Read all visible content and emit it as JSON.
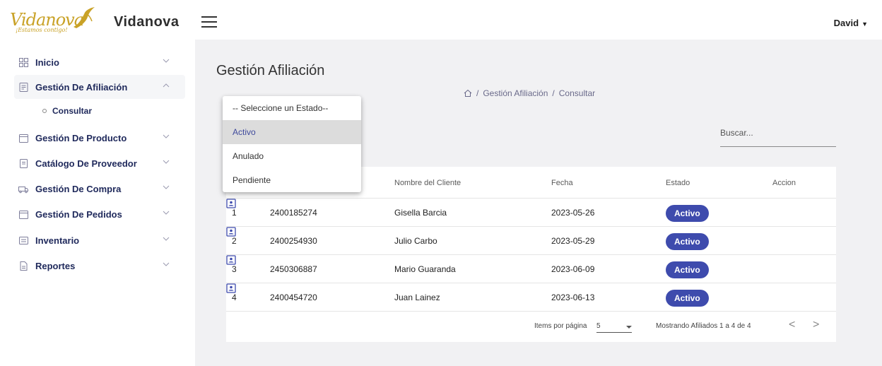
{
  "header": {
    "logo_text": "Vidanova",
    "logo_tagline": "¡Estamos contigo!",
    "brand": "Vidanova",
    "user": "David"
  },
  "sidebar": {
    "items": [
      {
        "label": "Inicio",
        "icon": "grid-icon"
      },
      {
        "label": "Gestión De Afiliación",
        "icon": "form-icon",
        "expanded": true,
        "children": [
          {
            "label": "Consultar"
          }
        ]
      },
      {
        "label": "Gestión De Producto",
        "icon": "calendar-icon"
      },
      {
        "label": "Catálogo De Proveedor",
        "icon": "document-icon"
      },
      {
        "label": "Gestión De Compra",
        "icon": "truck-icon"
      },
      {
        "label": "Gestión De Pedidos",
        "icon": "calendar-icon"
      },
      {
        "label": "Inventario",
        "icon": "list-icon"
      },
      {
        "label": "Reportes",
        "icon": "file-icon"
      }
    ]
  },
  "main": {
    "title": "Gestión Afiliación",
    "breadcrumb": {
      "home_icon": "home-icon",
      "sep": "/",
      "section": "Gestión Afiliación",
      "page": "Consultar"
    },
    "search_placeholder": "Buscar...",
    "estado_dropdown": {
      "options": [
        "-- Seleccione un Estado--",
        "Activo",
        "Anulado",
        "Pendiente"
      ],
      "highlighted": "Activo"
    },
    "table": {
      "columns": [
        "Nombre del Cliente",
        "Fecha",
        "Estado",
        "Accion"
      ],
      "rows": [
        {
          "n": "1",
          "id": "2400185274",
          "name": "Gisella Barcia",
          "date": "2023-05-26",
          "status": "Activo"
        },
        {
          "n": "2",
          "id": "2400254930",
          "name": "Julio Carbo",
          "date": "2023-05-29",
          "status": "Activo"
        },
        {
          "n": "3",
          "id": "2450306887",
          "name": "Mario Guaranda",
          "date": "2023-06-09",
          "status": "Activo"
        },
        {
          "n": "4",
          "id": "2400454720",
          "name": "Juan Lainez",
          "date": "2023-06-13",
          "status": "Activo"
        }
      ],
      "action_icon": "contact-card-icon"
    },
    "pager": {
      "items_label": "Items por página",
      "page_size": "5",
      "range": "Mostrando Afiliados 1 a 4 de 4",
      "prev": "<",
      "next": ">"
    }
  },
  "colors": {
    "accent": "#3e4bad",
    "nav_text": "#202a5c",
    "logo_gold": "#c9a227",
    "main_bg": "#f1f1f3"
  }
}
